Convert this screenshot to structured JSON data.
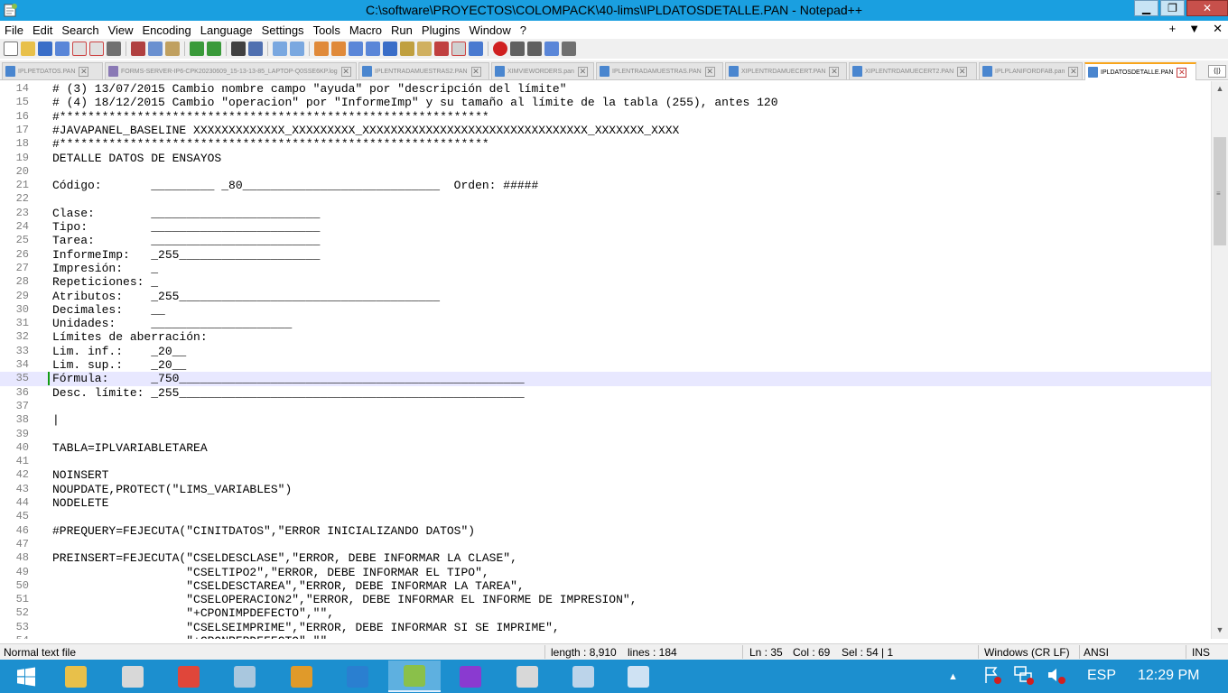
{
  "window": {
    "title": "C:\\software\\PROYECTOS\\COLOMPACK\\40-lims\\IPLDATOSDETALLE.PAN - Notepad++",
    "minimize": "▁",
    "maximize": "❐",
    "close": "✕"
  },
  "menu": {
    "items": [
      "File",
      "Edit",
      "Search",
      "View",
      "Encoding",
      "Language",
      "Settings",
      "Tools",
      "Macro",
      "Run",
      "Plugins",
      "Window",
      "?"
    ],
    "right": [
      "+",
      "▼",
      "✕"
    ]
  },
  "tabs": [
    {
      "label": "IPLPETDATOS.PAN",
      "icon": "file-icon"
    },
    {
      "label": "FORMS-SERVER-IP6-CPK20230609_15-13-13-85_LAPTOP-Q0SSE6KP.log",
      "icon": "log-icon"
    },
    {
      "label": "IPLENTRADAMUESTRAS2.PAN",
      "icon": "file-icon"
    },
    {
      "label": "XIMVIEWORDERS.pan",
      "icon": "file-icon"
    },
    {
      "label": "IPLENTRADAMUESTRAS.PAN",
      "icon": "file-icon"
    },
    {
      "label": "XIPLENTRDAMUECERT.PAN",
      "icon": "file-icon"
    },
    {
      "label": "XIPLENTRDAMUECERT2.PAN",
      "icon": "file-icon"
    },
    {
      "label": "IPLPLANIFORDFAB.pan",
      "icon": "file-icon"
    },
    {
      "label": "IPLDATOSDETALLE.PAN",
      "icon": "file-icon",
      "active": true
    }
  ],
  "tab_scroll": "⟨|⟩",
  "editor": {
    "lines": [
      {
        "n": "14",
        "t": "# (3) 13/07/2015 Cambio nombre campo \"ayuda\" por \"descripción del límite\""
      },
      {
        "n": "15",
        "t": "# (4) 18/12/2015 Cambio \"operacion\" por \"InformeImp\" y su tamaño al límite de la tabla (255), antes 120"
      },
      {
        "n": "16",
        "t": "#*************************************************************"
      },
      {
        "n": "17",
        "t": "#JAVAPANEL_BASELINE XXXXXXXXXXXXX_XXXXXXXXX_XXXXXXXXXXXXXXXXXXXXXXXXXXXXXXXX_XXXXXXX_XXXX"
      },
      {
        "n": "18",
        "t": "#*************************************************************"
      },
      {
        "n": "19",
        "t": "DETALLE DATOS DE ENSAYOS"
      },
      {
        "n": "20",
        "t": ""
      },
      {
        "n": "21",
        "t": "Código:       _________ _80____________________________  Orden: #####"
      },
      {
        "n": "22",
        "t": ""
      },
      {
        "n": "23",
        "t": "Clase:        ________________________"
      },
      {
        "n": "24",
        "t": "Tipo:         ________________________"
      },
      {
        "n": "25",
        "t": "Tarea:        ________________________"
      },
      {
        "n": "26",
        "t": "InformeImp:   _255____________________"
      },
      {
        "n": "27",
        "t": "Impresión:    _"
      },
      {
        "n": "28",
        "t": "Repeticiones: _"
      },
      {
        "n": "29",
        "t": "Atributos:    _255_____________________________________"
      },
      {
        "n": "30",
        "t": "Decimales:    __"
      },
      {
        "n": "31",
        "t": "Unidades:     ____________________"
      },
      {
        "n": "32",
        "t": "Límites de aberración:"
      },
      {
        "n": "33",
        "t": "Lim. inf.:    _20__"
      },
      {
        "n": "34",
        "t": "Lim. sup.:    _20__"
      },
      {
        "n": "35",
        "t": "Fórmula:      _750_________________________________________________",
        "current": true
      },
      {
        "n": "36",
        "t": "Desc. límite: _255_________________________________________________"
      },
      {
        "n": "37",
        "t": ""
      },
      {
        "n": "38",
        "t": "|"
      },
      {
        "n": "39",
        "t": ""
      },
      {
        "n": "40",
        "t": "TABLA=IPLVARIABLETAREA"
      },
      {
        "n": "41",
        "t": ""
      },
      {
        "n": "42",
        "t": "NOINSERT"
      },
      {
        "n": "43",
        "t": "NOUPDATE,PROTECT(\"LIMS_VARIABLES\")"
      },
      {
        "n": "44",
        "t": "NODELETE"
      },
      {
        "n": "45",
        "t": ""
      },
      {
        "n": "46",
        "t": "#PREQUERY=FEJECUTA(\"CINITDATOS\",\"ERROR INICIALIZANDO DATOS\")"
      },
      {
        "n": "47",
        "t": ""
      },
      {
        "n": "48",
        "t": "PREINSERT=FEJECUTA(\"CSELDESCLASE\",\"ERROR, DEBE INFORMAR LA CLASE\","
      },
      {
        "n": "49",
        "t": "                   \"CSELTIPO2\",\"ERROR, DEBE INFORMAR EL TIPO\","
      },
      {
        "n": "50",
        "t": "                   \"CSELDESCTAREA\",\"ERROR, DEBE INFORMAR LA TAREA\","
      },
      {
        "n": "51",
        "t": "                   \"CSELOPERACION2\",\"ERROR, DEBE INFORMAR EL INFORME DE IMPRESION\","
      },
      {
        "n": "52",
        "t": "                   \"+CPONIMPDEFECTO\",\"\","
      },
      {
        "n": "53",
        "t": "                   \"CSELSEIMPRIME\",\"ERROR, DEBE INFORMAR SI SE IMPRIME\","
      },
      {
        "n": "54",
        "t": "                   \"+CPONREPDEFECTO\",\"\","
      }
    ]
  },
  "scrollbar": {
    "up": "▲",
    "down": "▼",
    "grip": "≡"
  },
  "status": {
    "type": "Normal text file",
    "length": "length : 8,910",
    "lines": "lines : 184",
    "ln": "Ln : 35",
    "col": "Col : 69",
    "sel": "Sel : 54 | 1",
    "eol": "Windows (CR LF)",
    "encoding": "ANSI",
    "mode": "INS"
  },
  "taskbar": {
    "apps": [
      {
        "name": "file-explorer-icon",
        "color": "#e8c04a"
      },
      {
        "name": "server-manager-icon",
        "color": "#d8d8d8"
      },
      {
        "name": "chrome-icon",
        "color": "#e0463a"
      },
      {
        "name": "settings-tool-icon",
        "color": "#a9c7de"
      },
      {
        "name": "pl-sql-icon",
        "color": "#e09a2a"
      },
      {
        "name": "vscode-icon",
        "color": "#2a7fd0"
      },
      {
        "name": "notepadpp-icon",
        "color": "#8ac04a",
        "active": true
      },
      {
        "name": "search-tool-icon",
        "color": "#8a3ad0"
      },
      {
        "name": "remote-app-icon",
        "color": "#d8d8d8"
      },
      {
        "name": "virtualbox-icon",
        "color": "#bcd4ea"
      },
      {
        "name": "note-app-icon",
        "color": "#cfe2f3"
      }
    ],
    "language": "ESP",
    "time": "12:29 PM",
    "tray_up": "▲"
  },
  "colors": {
    "titlebar": "#1a9fe0",
    "selection": "#66cc66",
    "current_line": "#e8e8ff",
    "taskbar": "#1c8fcf"
  }
}
